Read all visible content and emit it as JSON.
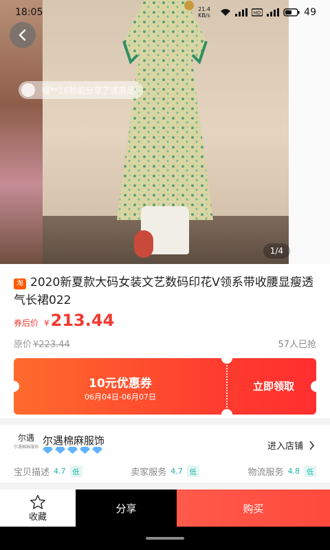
{
  "status_bar": {
    "time": "18:05",
    "net_speed": "21.4 KB/s",
    "battery": "49"
  },
  "hero": {
    "counter": "1/4",
    "toast": "喵**16秒前分享了该商品"
  },
  "product": {
    "badge": "淘",
    "title": "2020新夏款大码女装文艺数码印花V领系带收腰显瘦透气长裙022",
    "price_tag": "券后价",
    "currency": "¥",
    "price": "213.44",
    "orig_label": "原价",
    "orig_price": "¥223.44",
    "sold": "57人已抢"
  },
  "coupon": {
    "amount": "10元优惠券",
    "dates": "06月04日-06月07日",
    "claim": "立即领取"
  },
  "shop": {
    "logo_text": "尔遇",
    "logo_sub": "尔遇棉麻服饰",
    "name": "尔遇棉麻服饰",
    "enter": "进入店铺",
    "rating_diamonds": 5,
    "scores": [
      {
        "label": "宝贝描述",
        "value": "4.7",
        "level": "低"
      },
      {
        "label": "卖家服务",
        "value": "4.7",
        "level": "低"
      },
      {
        "label": "物流服务",
        "value": "4.8",
        "level": "低"
      }
    ]
  },
  "actions": {
    "favorite": "收藏",
    "share": "分享",
    "buy": "购买"
  },
  "colors": {
    "accent": "#f23a32",
    "coupon_start": "#ff6b2c",
    "coupon_end": "#ff2f2f",
    "score": "#19b3a8"
  }
}
